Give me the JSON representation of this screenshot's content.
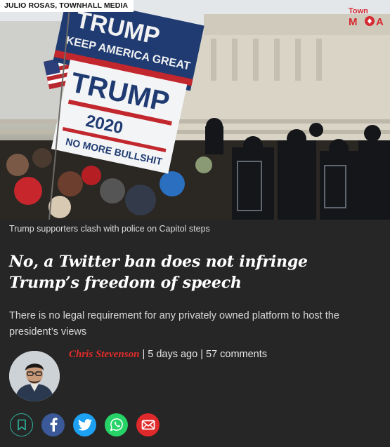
{
  "hero": {
    "credit": "JULIO ROSAS, TOWNHALL MEDIA",
    "watermark": "Townhall Media",
    "flag_texts": {
      "top_flag": "TRUMP\nKEEP AMERICA GREAT",
      "front_flag": "TRUMP 2020\nNO MORE BULLSHIT"
    }
  },
  "caption": "Trump supporters clash with police on Capitol steps",
  "headline": "No, a Twitter ban does not infringe Trump’s freedom of speech",
  "standfirst": "There is no legal requirement for any privately owned platform to host the president’s views",
  "byline": {
    "author": "Chris Stevenson",
    "separator": "|",
    "time_ago": "5 days ago",
    "comments": "57 comments"
  },
  "share": {
    "icons": [
      "bookmark-icon",
      "facebook-icon",
      "twitter-icon",
      "whatsapp-icon",
      "email-icon"
    ]
  },
  "colors": {
    "background": "#262626",
    "author": "#e32b2b",
    "bookmark_ring": "#2fb39d",
    "facebook": "#3b5998",
    "twitter": "#1da1f2",
    "whatsapp": "#25d366",
    "email": "#e0292b"
  }
}
